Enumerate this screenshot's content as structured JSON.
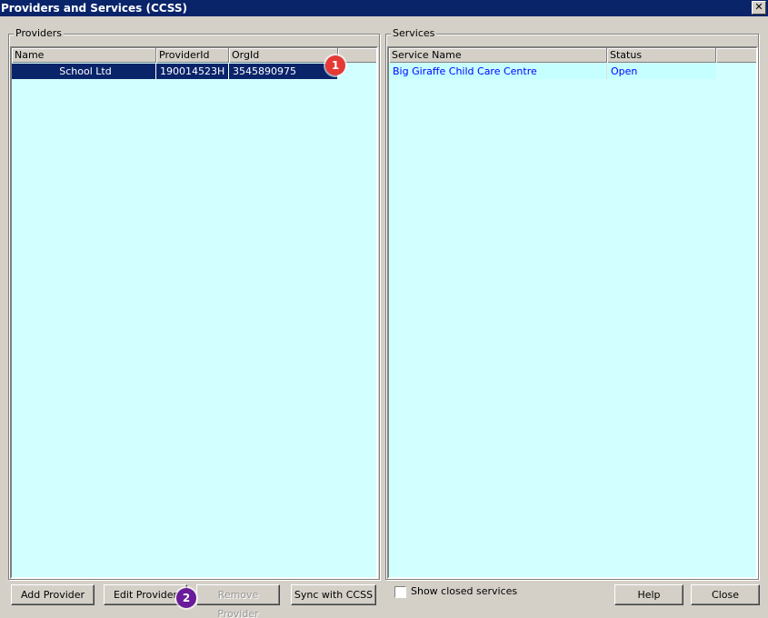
{
  "window": {
    "title": "Providers and Services (CCSS)",
    "close_glyph": "✕"
  },
  "providers": {
    "group_label": "Providers",
    "columns": [
      "Name",
      "ProviderId",
      "OrgId"
    ],
    "rows": [
      {
        "name": "School Ltd",
        "provider_id": "190014523H",
        "org_id": "3545890975"
      }
    ],
    "buttons": {
      "add": "Add Provider",
      "edit": "Edit Provider",
      "remove": "Remove Provider",
      "sync": "Sync with CCSS"
    }
  },
  "services": {
    "group_label": "Services",
    "columns": [
      "Service Name",
      "Status"
    ],
    "rows": [
      {
        "service_name": "Big Giraffe Child Care Centre",
        "status": "Open"
      }
    ],
    "show_closed_label": "Show closed services",
    "show_closed_checked": false
  },
  "footer_buttons": {
    "help": "Help",
    "close": "Close"
  },
  "annotations": [
    {
      "number": "1",
      "color": "#e53935"
    },
    {
      "number": "2",
      "color": "#6a1b9a"
    }
  ]
}
